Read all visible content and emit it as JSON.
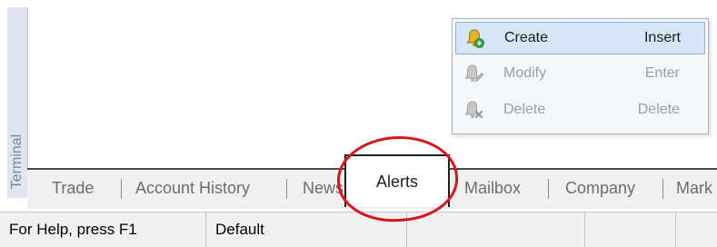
{
  "terminal": {
    "side_label": "Terminal"
  },
  "context_menu": {
    "items": [
      {
        "label": "Create",
        "shortcut": "Insert",
        "icon": "bell-add-icon",
        "enabled": true
      },
      {
        "label": "Modify",
        "shortcut": "Enter",
        "icon": "bell-edit-icon",
        "enabled": false
      },
      {
        "label": "Delete",
        "shortcut": "Delete",
        "icon": "bell-delete-icon",
        "enabled": false
      }
    ]
  },
  "tabs": {
    "trade": "Trade",
    "account_history": "Account History",
    "news": "News",
    "alerts": "Alerts",
    "mailbox": "Mailbox",
    "company": "Company",
    "market": "Mark"
  },
  "status_bar": {
    "help": "For Help, press F1",
    "profile": "Default"
  },
  "colors": {
    "annotation_circle": "#d9141d",
    "menu_highlight": "#d7e5f8"
  }
}
